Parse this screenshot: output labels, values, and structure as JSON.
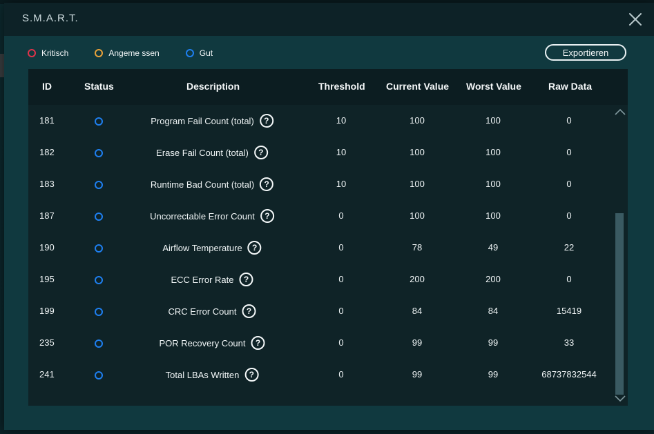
{
  "modal": {
    "title": "S.M.A.R.T.",
    "close_icon": "close-icon"
  },
  "legend": [
    {
      "label": "Kritisch",
      "color": "#e0334a"
    },
    {
      "label": "Angeme ssen",
      "color": "#e8a23a"
    },
    {
      "label": "Gut",
      "color": "#1e7ff0"
    }
  ],
  "export_label": "Exportieren",
  "columns": {
    "id": "ID",
    "status": "Status",
    "description": "Description",
    "threshold": "Threshold",
    "current": "Current Value",
    "worst": "Worst Value",
    "raw": "Raw Data"
  },
  "rows": [
    {
      "id": "181",
      "status": "good",
      "description": "Program Fail Count (total)",
      "threshold": "10",
      "current": "100",
      "worst": "100",
      "raw": "0"
    },
    {
      "id": "182",
      "status": "good",
      "description": "Erase Fail Count (total)",
      "threshold": "10",
      "current": "100",
      "worst": "100",
      "raw": "0"
    },
    {
      "id": "183",
      "status": "good",
      "description": "Runtime Bad Count (total)",
      "threshold": "10",
      "current": "100",
      "worst": "100",
      "raw": "0"
    },
    {
      "id": "187",
      "status": "good",
      "description": "Uncorrectable Error Count",
      "threshold": "0",
      "current": "100",
      "worst": "100",
      "raw": "0"
    },
    {
      "id": "190",
      "status": "good",
      "description": "Airflow Temperature",
      "threshold": "0",
      "current": "78",
      "worst": "49",
      "raw": "22"
    },
    {
      "id": "195",
      "status": "good",
      "description": "ECC Error Rate",
      "threshold": "0",
      "current": "200",
      "worst": "200",
      "raw": "0"
    },
    {
      "id": "199",
      "status": "good",
      "description": "CRC Error Count",
      "threshold": "0",
      "current": "84",
      "worst": "84",
      "raw": "15419"
    },
    {
      "id": "235",
      "status": "good",
      "description": "POR Recovery Count",
      "threshold": "0",
      "current": "99",
      "worst": "99",
      "raw": "33"
    },
    {
      "id": "241",
      "status": "good",
      "description": "Total LBAs Written",
      "threshold": "0",
      "current": "99",
      "worst": "99",
      "raw": "68737832544"
    }
  ],
  "help_glyph": "?",
  "status_color": "#1e7ff0",
  "scroll_position": 0.6
}
